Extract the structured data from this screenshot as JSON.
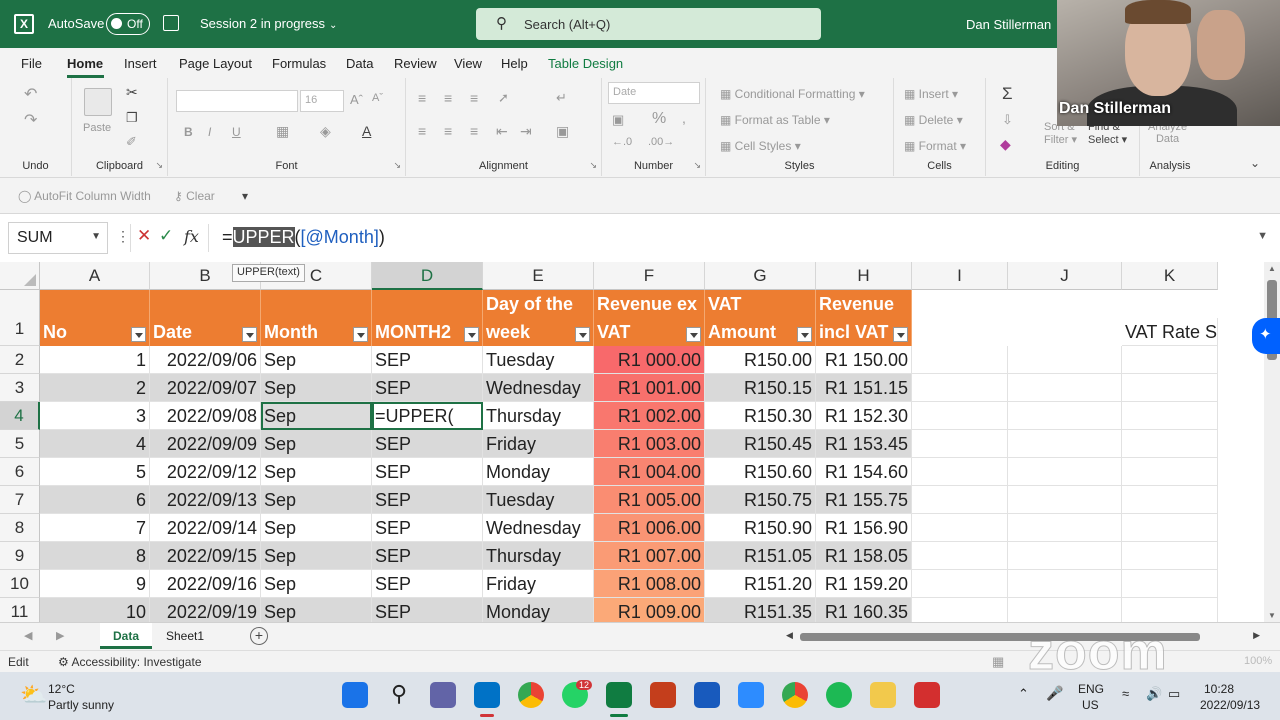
{
  "titlebar": {
    "autosave_label": "AutoSave",
    "autosave_state": "Off",
    "doc_title": "Session 2 in progress",
    "search_placeholder": "Search (Alt+Q)",
    "user_name": "Dan Stillerman"
  },
  "menu": [
    "File",
    "Home",
    "Insert",
    "Page Layout",
    "Formulas",
    "Data",
    "Review",
    "View",
    "Help",
    "Table Design"
  ],
  "ribbon": {
    "undo": {
      "label": "Undo"
    },
    "clipboard": {
      "label": "Clipboard",
      "paste": "Paste"
    },
    "font": {
      "label": "Font",
      "size": "16"
    },
    "alignment": {
      "label": "Alignment"
    },
    "number": {
      "label": "Number",
      "format": "Date"
    },
    "styles": {
      "label": "Styles",
      "items": [
        "Conditional Formatting",
        "Format as Table",
        "Cell Styles"
      ]
    },
    "cells": {
      "label": "Cells",
      "items": [
        "Insert",
        "Delete",
        "Format"
      ]
    },
    "editing": {
      "label": "Editing",
      "sort": "Sort &",
      "filter": "Filter",
      "find": "Find &",
      "select": "Select"
    },
    "analysis": {
      "label": "Analysis",
      "line1": "Analyze",
      "line2": "Data"
    }
  },
  "subbar": {
    "autofit": "AutoFit Column Width",
    "clear": "Clear"
  },
  "formula_bar": {
    "name_box": "SUM",
    "eq": "=",
    "fn_name": "UPPER",
    "paren": "(",
    "ref": "[@Month]",
    "close": ")",
    "tooltip": "UPPER(text)"
  },
  "grid": {
    "columns": [
      "A",
      "B",
      "C",
      "D",
      "E",
      "F",
      "G",
      "H",
      "I",
      "J",
      "K"
    ],
    "header_row": {
      "A": "No",
      "B": "Date",
      "C": "Month",
      "D": "MONTH2",
      "E1": "Day of the",
      "E2": "week",
      "F1": "Revenue ex",
      "F2": "VAT",
      "G1": "VAT",
      "G2": "Amount",
      "H1": "Revenue",
      "H2": "incl VAT",
      "K": "VAT Rate S"
    },
    "rows": [
      {
        "row": "2",
        "no": "1",
        "date": "2022/09/06",
        "month": "Sep",
        "month2": "SEP",
        "day": "Tuesday",
        "rev_ex": "R1 000.00",
        "vat": "R150.00",
        "rev_incl": "R1 150.00"
      },
      {
        "row": "3",
        "no": "2",
        "date": "2022/09/07",
        "month": "Sep",
        "month2": "SEP",
        "day": "Wednesday",
        "rev_ex": "R1 001.00",
        "vat": "R150.15",
        "rev_incl": "R1 151.15"
      },
      {
        "row": "4",
        "no": "3",
        "date": "2022/09/08",
        "month": "Sep",
        "month2": "=UPPER(",
        "day": "Thursday",
        "rev_ex": "R1 002.00",
        "vat": "R150.30",
        "rev_incl": "R1 152.30"
      },
      {
        "row": "5",
        "no": "4",
        "date": "2022/09/09",
        "month": "Sep",
        "month2": "SEP",
        "day": "Friday",
        "rev_ex": "R1 003.00",
        "vat": "R150.45",
        "rev_incl": "R1 153.45"
      },
      {
        "row": "6",
        "no": "5",
        "date": "2022/09/12",
        "month": "Sep",
        "month2": "SEP",
        "day": "Monday",
        "rev_ex": "R1 004.00",
        "vat": "R150.60",
        "rev_incl": "R1 154.60"
      },
      {
        "row": "7",
        "no": "6",
        "date": "2022/09/13",
        "month": "Sep",
        "month2": "SEP",
        "day": "Tuesday",
        "rev_ex": "R1 005.00",
        "vat": "R150.75",
        "rev_incl": "R1 155.75"
      },
      {
        "row": "8",
        "no": "7",
        "date": "2022/09/14",
        "month": "Sep",
        "month2": "SEP",
        "day": "Wednesday",
        "rev_ex": "R1 006.00",
        "vat": "R150.90",
        "rev_incl": "R1 156.90"
      },
      {
        "row": "9",
        "no": "8",
        "date": "2022/09/15",
        "month": "Sep",
        "month2": "SEP",
        "day": "Thursday",
        "rev_ex": "R1 007.00",
        "vat": "R151.05",
        "rev_incl": "R1 158.05"
      },
      {
        "row": "10",
        "no": "9",
        "date": "2022/09/16",
        "month": "Sep",
        "month2": "SEP",
        "day": "Friday",
        "rev_ex": "R1 008.00",
        "vat": "R151.20",
        "rev_incl": "R1 159.20"
      },
      {
        "row": "11",
        "no": "10",
        "date": "2022/09/19",
        "month": "Sep",
        "month2": "SEP",
        "day": "Monday",
        "rev_ex": "R1 009.00",
        "vat": "R151.35",
        "rev_incl": "R1 160.35"
      }
    ]
  },
  "colors": {
    "excel_green": "#1e7145",
    "table_header": "#ed7d31",
    "band_row": "#d9d9d9",
    "heat_red": "#f8696b",
    "heat_orange": "#fba978"
  },
  "sheets": [
    "Data",
    "Sheet1"
  ],
  "status": {
    "mode": "Edit",
    "accessibility": "Accessibility: Investigate",
    "zoom": "100%"
  },
  "taskbar": {
    "weather_temp": "12°C",
    "weather_desc": "Partly sunny",
    "lang1": "ENG",
    "lang2": "US",
    "time": "10:28",
    "date": "2022/09/13",
    "whatsapp_badge": "12"
  },
  "webcam": {
    "name": "Dan Stillerman"
  },
  "watermark": "zoom"
}
